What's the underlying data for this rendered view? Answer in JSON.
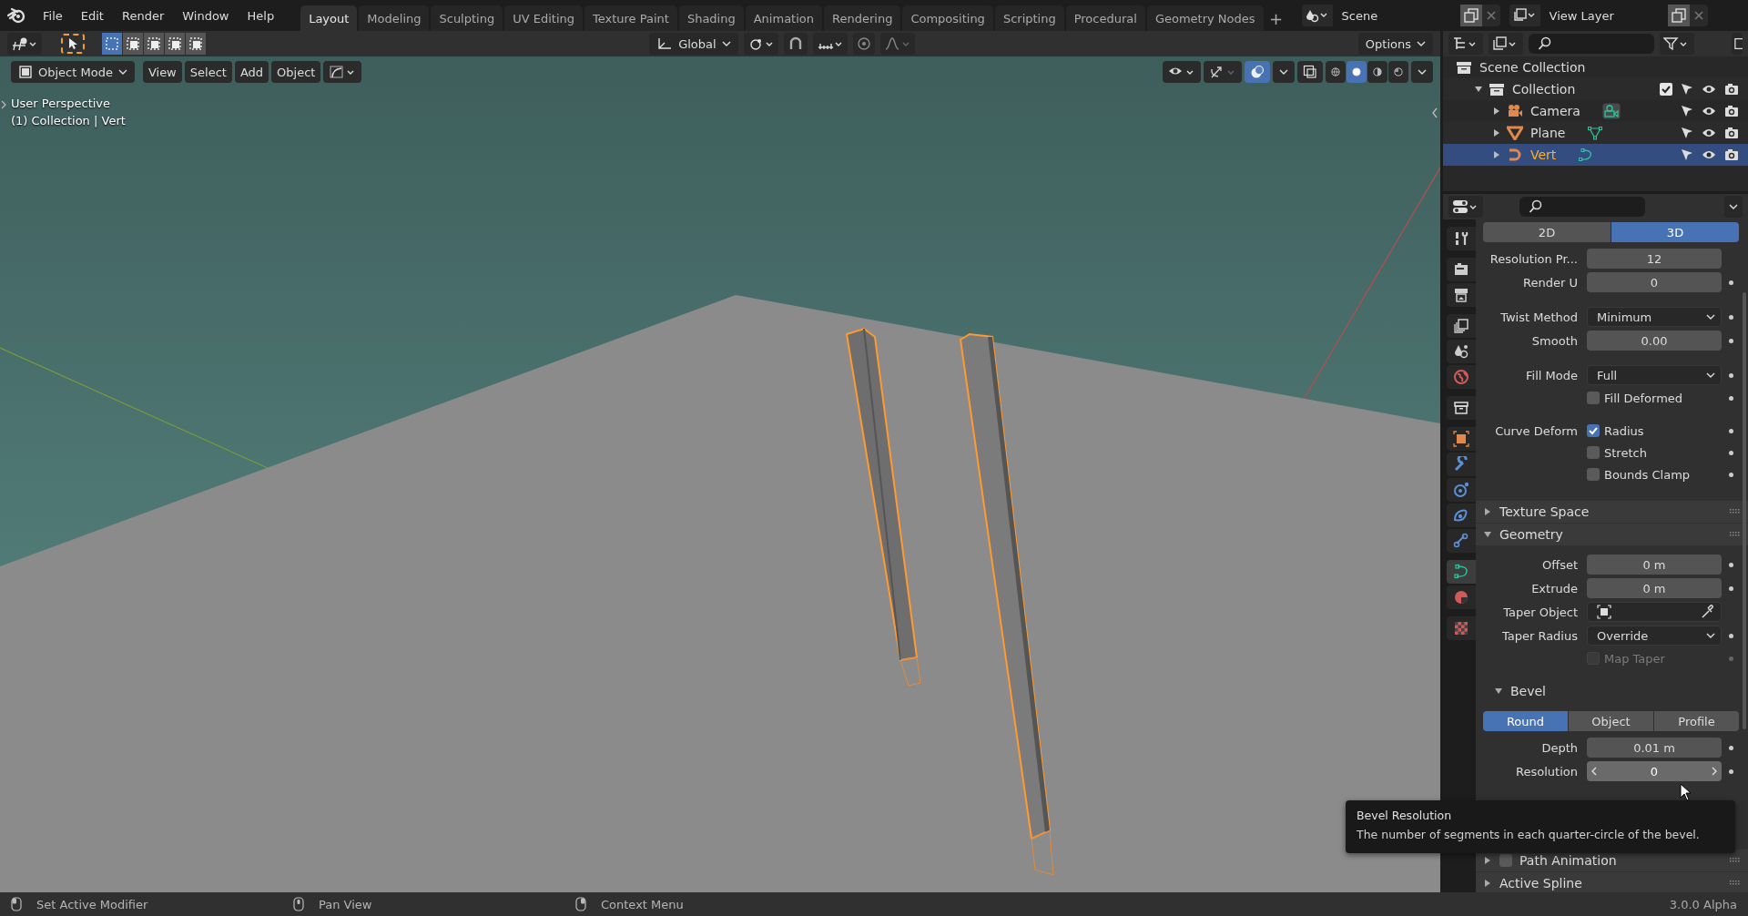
{
  "menus": [
    "File",
    "Edit",
    "Render",
    "Window",
    "Help"
  ],
  "workspaces": [
    {
      "label": "Layout",
      "selected": true
    },
    {
      "label": "Modeling",
      "selected": false
    },
    {
      "label": "Sculpting",
      "selected": false
    },
    {
      "label": "UV Editing",
      "selected": false
    },
    {
      "label": "Texture Paint",
      "selected": false
    },
    {
      "label": "Shading",
      "selected": false
    },
    {
      "label": "Animation",
      "selected": false
    },
    {
      "label": "Rendering",
      "selected": false
    },
    {
      "label": "Compositing",
      "selected": false
    },
    {
      "label": "Scripting",
      "selected": false
    },
    {
      "label": "Procedural",
      "selected": false
    },
    {
      "label": "Geometry Nodes",
      "selected": false
    }
  ],
  "add_workspace": "+",
  "scene": "Scene",
  "view_layer": "View Layer",
  "tool_header": {
    "select_modes": [
      {
        "selected": true
      },
      {
        "selected": false
      },
      {
        "selected": false
      },
      {
        "selected": false
      },
      {
        "selected": false
      }
    ],
    "orientation": "Global",
    "options": "Options"
  },
  "viewport": {
    "mode": "Object Mode",
    "menus": [
      "View",
      "Select",
      "Add",
      "Object"
    ],
    "shading_modes": [
      {
        "selected": false
      },
      {
        "selected": true
      },
      {
        "selected": false
      },
      {
        "selected": false
      }
    ],
    "overlay_text": [
      "User Perspective",
      "(1) Collection | Vert"
    ]
  },
  "outliner": {
    "items": [
      {
        "name": "Scene Collection",
        "kind": "scene_collection",
        "selected": false,
        "children": [
          {
            "name": "Collection",
            "kind": "collection",
            "expanded": true,
            "selected": false,
            "checked": true,
            "children": [
              {
                "name": "Camera",
                "kind": "camera",
                "expanded": false,
                "selected": false
              },
              {
                "name": "Plane",
                "kind": "mesh",
                "expanded": false,
                "selected": false
              },
              {
                "name": "Vert",
                "kind": "curve",
                "expanded": false,
                "selected": true
              }
            ]
          }
        ]
      }
    ]
  },
  "properties": {
    "tabs": [
      {
        "kind": "tool",
        "selected": false
      },
      {
        "kind": "render",
        "selected": false
      },
      {
        "kind": "output",
        "selected": false
      },
      {
        "kind": "view_layer",
        "selected": false
      },
      {
        "kind": "scene",
        "selected": false
      },
      {
        "kind": "world",
        "selected": false
      },
      {
        "kind": "collection",
        "selected": false
      },
      {
        "kind": "object",
        "selected": false
      },
      {
        "kind": "modifier",
        "selected": false
      },
      {
        "kind": "particles",
        "selected": false
      },
      {
        "kind": "physics",
        "selected": false
      },
      {
        "kind": "constraints",
        "selected": false
      },
      {
        "kind": "data",
        "selected": true
      },
      {
        "kind": "material",
        "selected": false
      },
      {
        "kind": "texture",
        "selected": false
      }
    ],
    "items": [
      {
        "kind": "segmented",
        "options": [
          {
            "label": "2D",
            "selected": false
          },
          {
            "label": "3D",
            "selected": true
          }
        ]
      },
      {
        "kind": "number",
        "label": "Resolution Pr...",
        "value": "12"
      },
      {
        "kind": "number",
        "label": "Render U",
        "value": "0",
        "dot": true
      },
      {
        "kind": "dropdown",
        "label": "Twist Method",
        "value": "Minimum",
        "dot": true
      },
      {
        "kind": "number",
        "label": "Smooth",
        "value": "0.00",
        "dot": true
      },
      {
        "kind": "dropdown",
        "label": "Fill Mode",
        "value": "Full",
        "dot": true
      },
      {
        "kind": "checkbox",
        "text": "Fill Deformed",
        "checked": false,
        "disabled": false,
        "dot": true
      },
      {
        "kind": "checkbox",
        "label": "Curve Deform",
        "text": "Radius",
        "checked": true,
        "disabled": false,
        "dot": true
      },
      {
        "kind": "checkbox",
        "text": "Stretch",
        "checked": false,
        "disabled": false,
        "dot": true
      },
      {
        "kind": "checkbox",
        "text": "Bounds Clamp",
        "checked": false,
        "disabled": false,
        "dot": true
      },
      {
        "kind": "panel",
        "title": "Texture Space",
        "expanded": false
      },
      {
        "kind": "panel",
        "title": "Geometry",
        "expanded": true
      },
      {
        "kind": "number",
        "label": "Offset",
        "value": "0 m",
        "dot": true
      },
      {
        "kind": "number",
        "label": "Extrude",
        "value": "0 m",
        "dot": true
      },
      {
        "kind": "object_field",
        "label": "Taper Object"
      },
      {
        "kind": "dropdown",
        "label": "Taper Radius",
        "value": "Override",
        "dot": true
      },
      {
        "kind": "checkbox",
        "text": "Map Taper",
        "checked": false,
        "disabled": true,
        "dot": true
      },
      {
        "kind": "subpanel",
        "title": "Bevel",
        "expanded": true
      },
      {
        "kind": "segmented",
        "options": [
          {
            "label": "Round",
            "selected": true
          },
          {
            "label": "Object",
            "selected": false
          },
          {
            "label": "Profile",
            "selected": false
          }
        ]
      },
      {
        "kind": "number",
        "label": "Depth",
        "value": "0.01 m",
        "dot": true
      },
      {
        "kind": "stepper",
        "label": "Resolution",
        "value": "0",
        "dot": true
      },
      {
        "kind": "covered"
      },
      {
        "kind": "panel",
        "title": "Path Animation",
        "expanded": false,
        "checked": false
      },
      {
        "kind": "panel",
        "title": "Active Spline",
        "expanded": false
      }
    ]
  },
  "tooltip": {
    "title": "Bevel Resolution",
    "body": "The number of segments in each quarter-circle of the bevel."
  },
  "status_bar": {
    "hints": [
      {
        "kind": "left",
        "text": "Set Active Modifier"
      },
      {
        "kind": "middle",
        "text": "Pan View"
      },
      {
        "kind": "right",
        "text": "Context Menu"
      }
    ],
    "version": "3.0.0 Alpha"
  }
}
